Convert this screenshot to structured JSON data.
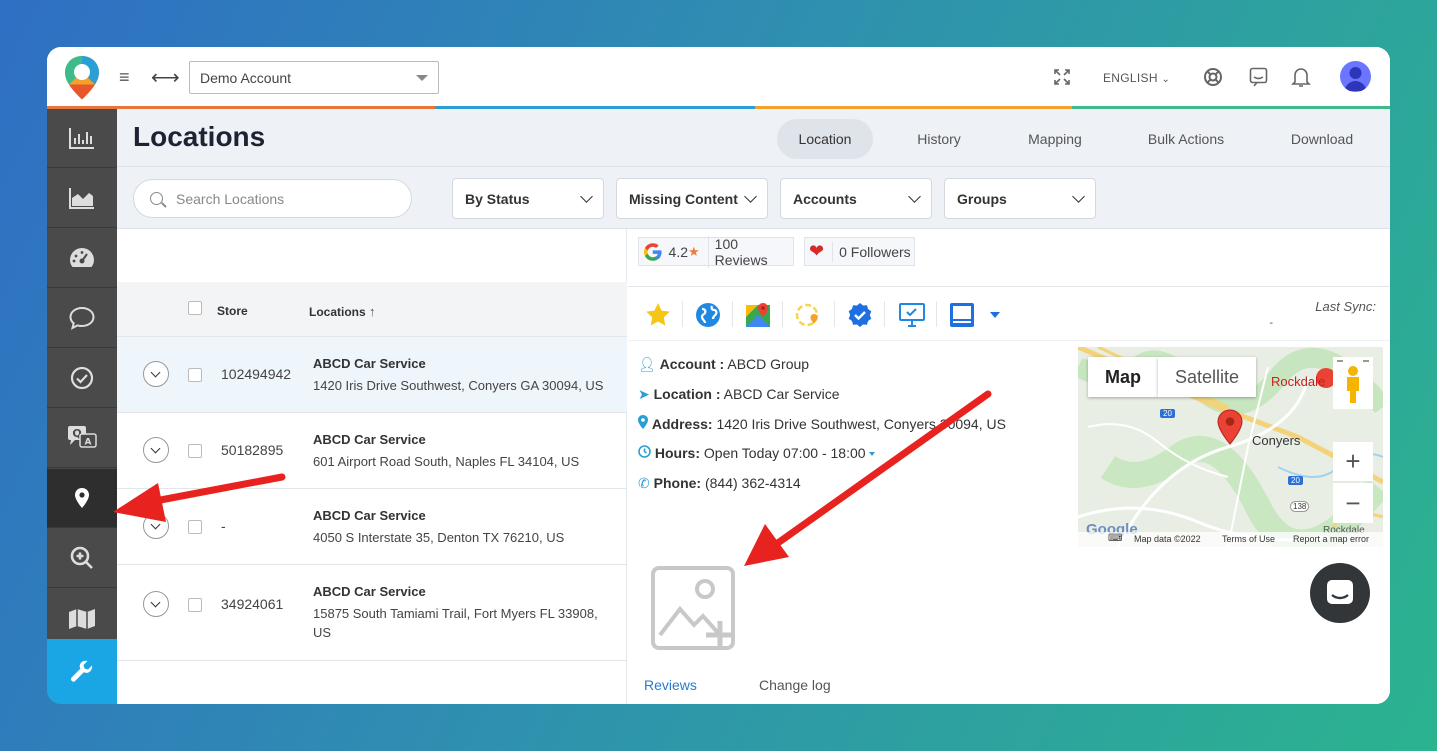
{
  "header": {
    "account_select": "Demo Account",
    "language": "ENGLISH",
    "icons": [
      "menu-icon",
      "expand-arrows-icon",
      "fullscreen-icon",
      "lifebuoy-icon",
      "chat-icon",
      "bell-icon",
      "user-avatar-icon"
    ]
  },
  "sidebar": {
    "items": [
      {
        "name": "reports",
        "icon": "bar-chart-icon"
      },
      {
        "name": "analytics",
        "icon": "area-chart-icon"
      },
      {
        "name": "dashboard",
        "icon": "gauge-icon"
      },
      {
        "name": "messages",
        "icon": "chat-bubble-icon"
      },
      {
        "name": "tasks",
        "icon": "check-circle-icon"
      },
      {
        "name": "qa",
        "icon": "qa-icon"
      },
      {
        "name": "locations",
        "icon": "map-pin-icon",
        "active": true
      },
      {
        "name": "search",
        "icon": "zoom-in-icon"
      },
      {
        "name": "map",
        "icon": "map-icon"
      },
      {
        "name": "tools",
        "icon": "wrench-icon"
      }
    ]
  },
  "page": {
    "title": "Locations",
    "tabs": [
      {
        "label": "Location",
        "active": true
      },
      {
        "label": "History"
      },
      {
        "label": "Mapping"
      },
      {
        "label": "Bulk Actions"
      },
      {
        "label": "Download"
      }
    ]
  },
  "filters": {
    "search_placeholder": "Search Locations",
    "dropdowns": [
      "By Status",
      "Missing Content",
      "Accounts",
      "Groups"
    ]
  },
  "table": {
    "col_store": "Store",
    "col_locations": "Locations",
    "rows": [
      {
        "store": "102494942",
        "name": "ABCD Car Service",
        "address": "1420 Iris Drive Southwest, Conyers GA 30094, US"
      },
      {
        "store": "50182895",
        "name": "ABCD Car Service",
        "address": "601 Airport Road South, Naples FL 34104, US"
      },
      {
        "store": "-",
        "name": "ABCD Car Service",
        "address": "4050 S Interstate 35, Denton TX 76210, US"
      },
      {
        "store": "34924061",
        "name": "ABCD Car Service",
        "address": "15875 South Tamiami Trail, Fort Myers FL 33908, US"
      }
    ]
  },
  "detail": {
    "rating": "4.2",
    "reviews": "100 Reviews",
    "followers": "0 Followers",
    "last_sync_label": "Last Sync:",
    "last_sync_value": "-",
    "account_label": "Account :",
    "account_value": "ABCD Group",
    "location_label": "Location :",
    "location_value": "ABCD Car Service",
    "address_label": "Address:",
    "address_value": "1420 Iris Drive Southwest, Conyers 30094, US",
    "hours_label": "Hours:",
    "hours_value": "Open Today 07:00 - 18:00",
    "phone_label": "Phone:",
    "phone_value": "(844) 362-4314",
    "bottom_tabs": [
      "Reviews",
      "Change log"
    ]
  },
  "map": {
    "map_btn": "Map",
    "satellite_btn": "Satellite",
    "label_city": "Conyers",
    "label_rockdale": "Rockdale",
    "label_rockdale2": "Rockdale",
    "shield_20a": "20",
    "shield_20b": "20",
    "shield_138": "138",
    "zoom_in": "+",
    "zoom_out": "−",
    "google": "Google",
    "attribution": "Map data ©2022",
    "terms": "Terms of Use",
    "report": "Report a map error"
  },
  "colors": {
    "accent": "#1aa6e4",
    "sidebar": "#4a4a4a",
    "annotation_arrow": "#e8231f"
  }
}
